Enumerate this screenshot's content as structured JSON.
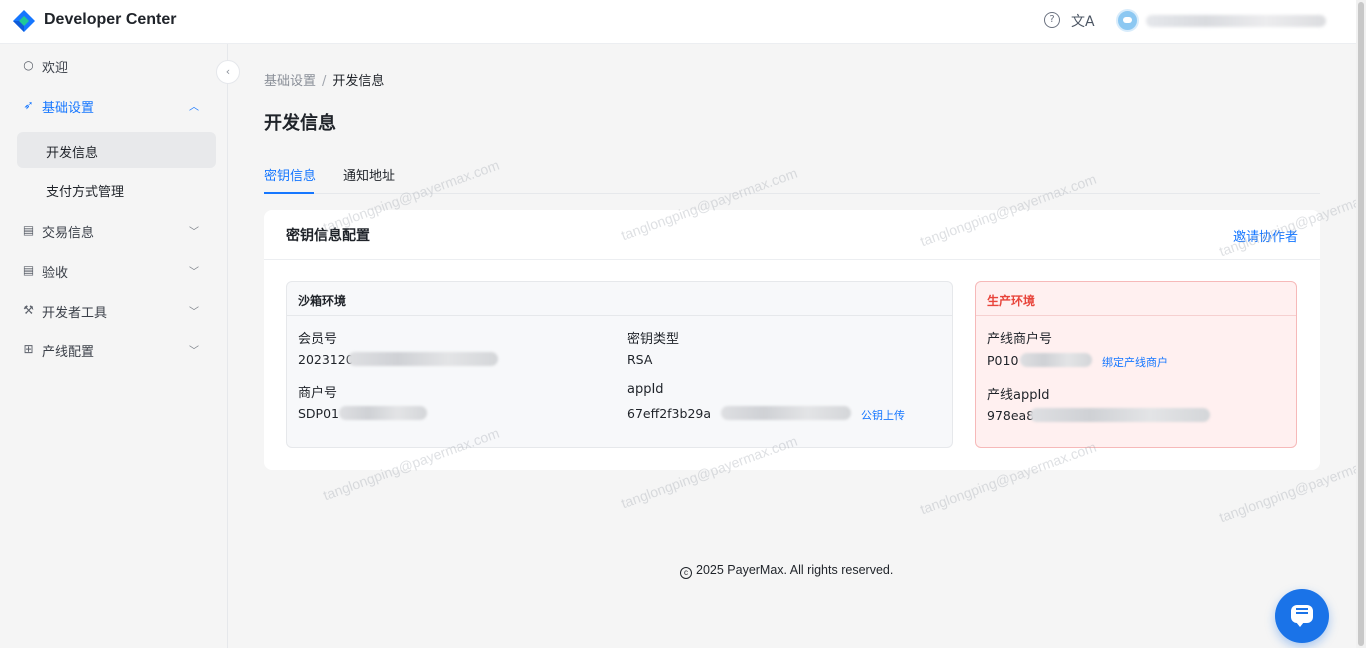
{
  "header": {
    "brand": "Developer Center",
    "icons": [
      "logo-icon",
      "help-icon",
      "translate-icon",
      "avatar"
    ]
  },
  "sidebar": {
    "items": [
      {
        "label": "欢迎",
        "icon": "bulb-icon"
      },
      {
        "label": "基础设置",
        "icon": "rocket-icon",
        "expanded": true
      },
      {
        "label": "开发信息",
        "selected": true
      },
      {
        "label": "支付方式管理"
      },
      {
        "label": "交易信息",
        "icon": "receipt-icon"
      },
      {
        "label": "验收",
        "icon": "receipt-icon"
      },
      {
        "label": "开发者工具",
        "icon": "wrench-icon"
      },
      {
        "label": "产线配置",
        "icon": "network-icon"
      }
    ]
  },
  "breadcrumb": {
    "parent": "基础设置",
    "separator": "/",
    "current": "开发信息"
  },
  "page_title": "开发信息",
  "tabs": [
    {
      "label": "密钥信息",
      "active": true
    },
    {
      "label": "通知地址",
      "active": false
    }
  ],
  "card": {
    "title": "密钥信息配置",
    "invite_label": "邀请协作者",
    "sandbox": {
      "title": "沙箱环境",
      "member_label": "会员号",
      "member_value": "2023120",
      "key_type_label": "密钥类型",
      "key_type_value": "RSA",
      "merchant_label": "商户号",
      "merchant_value": "SDP01",
      "appid_label": "appId",
      "appid_value": "67eff2f3b29a",
      "upload_link": "公钥上传"
    },
    "production": {
      "title": "生产环境",
      "merchant_label": "产线商户号",
      "merchant_value": "P010",
      "bind_link": "绑定产线商户",
      "appid_label": "产线appId",
      "appid_value": "978ea8"
    }
  },
  "footer": {
    "text": "2025 PayerMax. All rights reserved."
  },
  "watermark": "tanglongping@payermax.com",
  "colors": {
    "accent": "#1677ff",
    "danger": "#e8453c",
    "prod_bg": "#fff0f0"
  }
}
